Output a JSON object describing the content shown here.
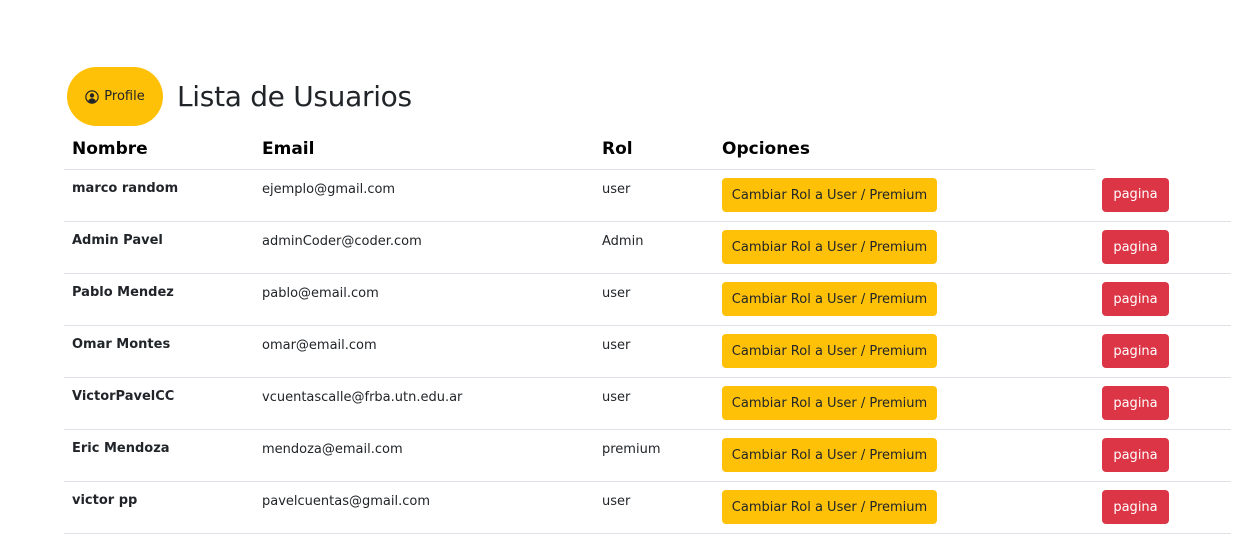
{
  "header": {
    "profile_label": "Profile",
    "title": "Lista de Usuarios"
  },
  "table": {
    "headers": {
      "name": "Nombre",
      "email": "Email",
      "role": "Rol",
      "options": "Opciones"
    },
    "role_button_label": "Cambiar Rol a User / Premium",
    "page_button_label": "pagina",
    "rows": [
      {
        "name": "marco random",
        "email": "ejemplo@gmail.com",
        "role": "user"
      },
      {
        "name": "Admin Pavel",
        "email": "adminCoder@coder.com",
        "role": "Admin"
      },
      {
        "name": "Pablo Mendez",
        "email": "pablo@email.com",
        "role": "user"
      },
      {
        "name": "Omar Montes",
        "email": "omar@email.com",
        "role": "user"
      },
      {
        "name": "VictorPavelCC",
        "email": "vcuentascalle@frba.utn.edu.ar",
        "role": "user"
      },
      {
        "name": "Eric Mendoza",
        "email": "mendoza@email.com",
        "role": "premium"
      },
      {
        "name": "victor pp",
        "email": "pavelcuentas@gmail.com",
        "role": "user"
      }
    ]
  },
  "colors": {
    "warning": "#ffc107",
    "danger": "#dc3545",
    "border": "#dee2e6",
    "text": "#212529"
  },
  "icons": {
    "profile": "person-circle-icon"
  }
}
